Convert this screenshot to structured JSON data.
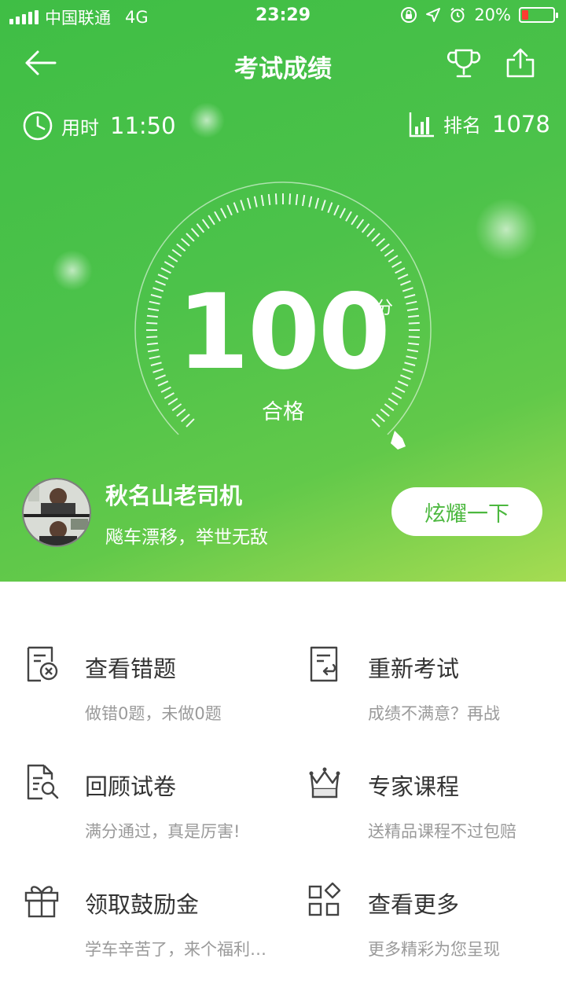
{
  "status_bar": {
    "carrier": "中国联通",
    "network": "4G",
    "time": "23:29",
    "battery": "20%",
    "battery_level": 0.2
  },
  "nav": {
    "title": "考试成绩",
    "back_icon": "back-arrow-icon",
    "trophy_icon": "trophy-icon",
    "share_icon": "share-icon"
  },
  "stats": {
    "time_label": "用时",
    "time_value": "11:50",
    "rank_label": "排名",
    "rank_value": "1078"
  },
  "result": {
    "score": "100",
    "unit": "分",
    "status": "合格",
    "score_fraction": 1.0
  },
  "user": {
    "name": "秋名山老司机",
    "motto": "飚车漂移，举世无敌"
  },
  "share_button": "炫耀一下",
  "actions": [
    {
      "title": "查看错题",
      "subtitle": "做错0题，未做0题",
      "icon": "wrong-answers-icon"
    },
    {
      "title": "重新考试",
      "subtitle": "成绩不满意？再战",
      "icon": "retake-exam-icon"
    },
    {
      "title": "回顾试卷",
      "subtitle": "满分通过，真是厉害!",
      "icon": "review-paper-icon"
    },
    {
      "title": "专家课程",
      "subtitle": "送精品课程不过包赔",
      "icon": "crown-icon"
    },
    {
      "title": "领取鼓励金",
      "subtitle": "学车辛苦了，来个福利…",
      "icon": "gift-icon"
    },
    {
      "title": "查看更多",
      "subtitle": "更多精彩为您呈现",
      "icon": "more-apps-icon"
    }
  ],
  "colors": {
    "primary_green": "#4cc24a",
    "button_text": "#4cb83f"
  }
}
